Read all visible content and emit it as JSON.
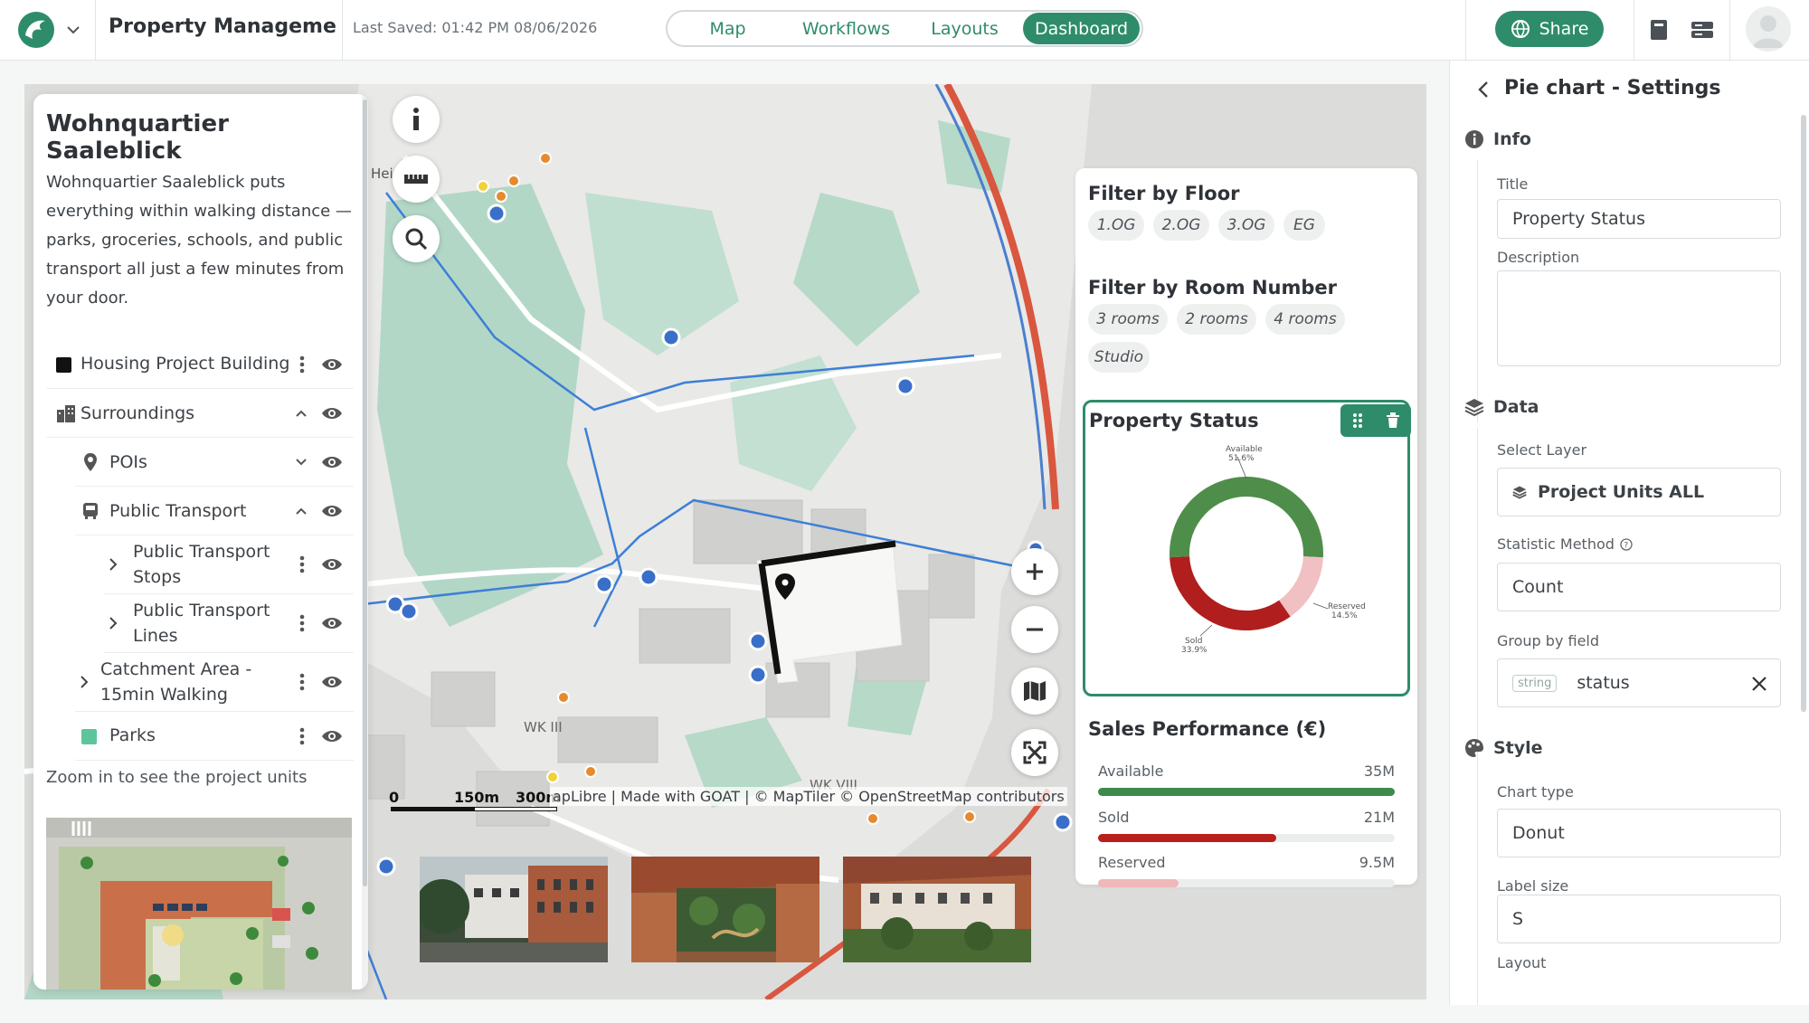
{
  "app": {
    "project_title": "Property Management...",
    "last_saved": "Last Saved: 01:42 PM 08/06/2026",
    "tabs": [
      "Map",
      "Workflows",
      "Layouts",
      "Dashboard"
    ],
    "active_tab": "Dashboard",
    "share_label": "Share",
    "accent_color": "#2f8c6a"
  },
  "left_panel": {
    "title": "Wohnquartier Saaleblick",
    "description": "Wohnquartier Saaleblick puts everything within walking distance — parks, groceries, schools, and public transport all just a few minutes from your door.",
    "layers": [
      {
        "label": "Housing Project Building",
        "icon": "black-square-icon"
      },
      {
        "label": "Surroundings",
        "icon": "city-icon"
      },
      {
        "label": "POIs",
        "icon": "map-pin-icon"
      },
      {
        "label": "Public Transport",
        "icon": "bus-icon"
      },
      {
        "label": "Public Transport Stops",
        "icon": "chevron-right-icon"
      },
      {
        "label": "Public Transport Lines",
        "icon": "chevron-right-icon"
      },
      {
        "label": "Catchment Area - 15min Walking",
        "icon": "chevron-right-icon"
      },
      {
        "label": "Parks",
        "icon": "green-square-icon"
      }
    ],
    "zoom_hint": "Zoom in to see the project units"
  },
  "map": {
    "labels": {
      "street_top": "Hei     d",
      "wk3": "WK III",
      "wk8": "WK VIII"
    },
    "scale": {
      "zero": "0",
      "mid": "150m",
      "end": "300m"
    },
    "attribution": "apLibre | Made with GOAT | © MapTiler © OpenStreetMap contributors"
  },
  "widgets": {
    "floor_filter": {
      "title": "Filter by Floor",
      "options": [
        "1.OG",
        "2.OG",
        "3.OG",
        "EG"
      ]
    },
    "room_filter": {
      "title": "Filter by Room Number",
      "options": [
        "3 rooms",
        "2 rooms",
        "4 rooms",
        "Studio"
      ]
    },
    "pie_title": "Property Status",
    "pie_labels": {
      "available": "Available",
      "available_pct": "51.6%",
      "reserved": "Reserved",
      "reserved_pct": "14.5%",
      "sold": "Sold",
      "sold_pct": "33.9%"
    },
    "sales_title": "Sales Performance (€)",
    "sales": [
      {
        "label": "Available",
        "value_text": "35M",
        "value": 35,
        "color": "#3d8a4c"
      },
      {
        "label": "Sold",
        "value_text": "21M",
        "value": 21,
        "color": "#b8201e"
      },
      {
        "label": "Reserved",
        "value_text": "9.5M",
        "value": 9.5,
        "color": "#f0b8bb"
      }
    ]
  },
  "chart_data": {
    "type": "pie",
    "title": "Property Status",
    "categories": [
      "Available",
      "Reserved",
      "Sold"
    ],
    "values": [
      51.6,
      14.5,
      33.9
    ],
    "colors": [
      "#4f8e4a",
      "#f0c0c2",
      "#b01e1e"
    ],
    "style": "donut"
  },
  "settings": {
    "header": "Pie chart - Settings",
    "info_section": "Info",
    "title_label": "Title",
    "title_value": "Property Status",
    "description_label": "Description",
    "description_value": "",
    "data_section": "Data",
    "select_layer_label": "Select Layer",
    "select_layer_value": "Project Units ALL",
    "statistic_label": "Statistic Method",
    "statistic_value": "Count",
    "group_label": "Group by field",
    "group_type": "string",
    "group_value": "status",
    "style_section": "Style",
    "chart_type_label": "Chart type",
    "chart_type_value": "Donut",
    "label_size_label": "Label size",
    "label_size_value": "S",
    "layout_label": "Layout"
  }
}
